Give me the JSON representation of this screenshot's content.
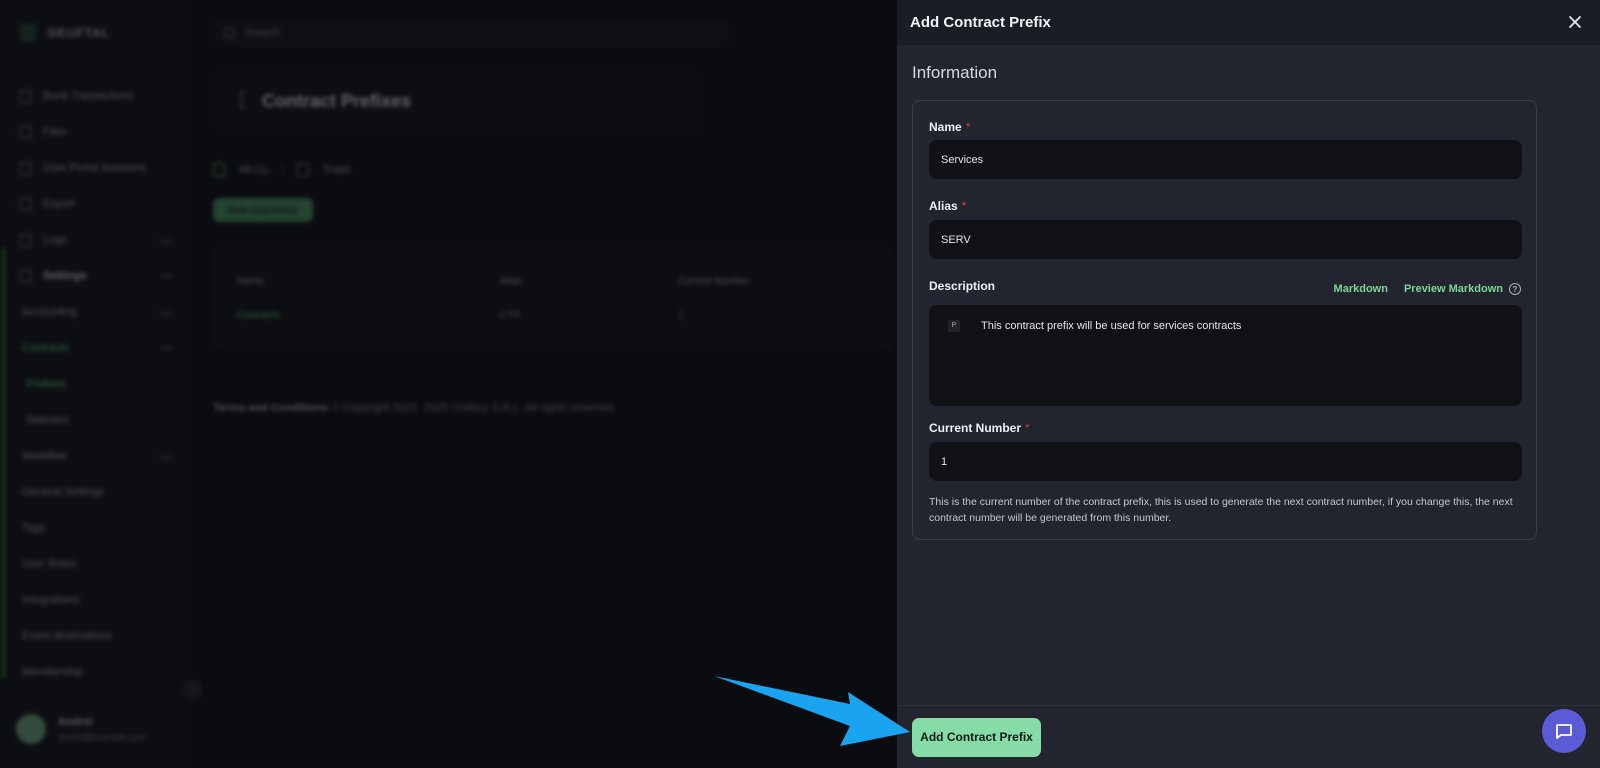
{
  "app": {
    "brand": "DEUFTAL",
    "search_placeholder": "Search",
    "page_title": "Contract Prefixes",
    "tabs": [
      {
        "label": "All (1)"
      },
      {
        "label": "Trash"
      }
    ],
    "bulk_button": "Bulk Operations",
    "table": {
      "headers": [
        "Name",
        "Alias",
        "Current Number"
      ],
      "rows": [
        {
          "name": "Contracts",
          "alias": "CTR",
          "current_number": "1"
        }
      ]
    },
    "footer": {
      "terms": "Terms and Conditions",
      "copyright": "© Copyright 2021- 2026 Onlihuy S.R.L. All rights reserved."
    },
    "sidebar": {
      "items": [
        {
          "label": "Bank Transactions"
        },
        {
          "label": "Files"
        },
        {
          "label": "User Portal Sessions"
        },
        {
          "label": "Export"
        },
        {
          "label": "Logs"
        },
        {
          "label": "Settings"
        },
        {
          "label": "Accounting"
        },
        {
          "label": "Contracts"
        },
        {
          "label": "Prefixes"
        },
        {
          "label": "Statuses"
        },
        {
          "label": "Workflow"
        },
        {
          "label": "General Settings"
        },
        {
          "label": "Tags"
        },
        {
          "label": "User Roles"
        },
        {
          "label": "Integrations"
        },
        {
          "label": "Event destinations"
        },
        {
          "label": "Membership"
        }
      ]
    },
    "user": {
      "name": "Andrei",
      "email": "andrei@example.com"
    }
  },
  "panel": {
    "title": "Add Contract Prefix",
    "section": "Information",
    "fields": {
      "name": {
        "label": "Name",
        "value": "Services"
      },
      "alias": {
        "label": "Alias",
        "value": "SERV"
      },
      "description": {
        "label": "Description",
        "markdown_link": "Markdown",
        "preview_link": "Preview Markdown",
        "paragraph_tag": "P",
        "value": "This contract prefix will be used for services contracts"
      },
      "current_number": {
        "label": "Current Number",
        "value": "1",
        "help": "This is the current number of the contract prefix, this is used to generate the next contract number, if you change this, the next contract number will be generated from this number."
      }
    },
    "required_marker": "*",
    "submit_label": "Add Contract Prefix"
  },
  "colors": {
    "accent_green": "#86dca7",
    "chat_button": "#5b5bd6",
    "annotation_arrow": "#1aa3ef"
  }
}
